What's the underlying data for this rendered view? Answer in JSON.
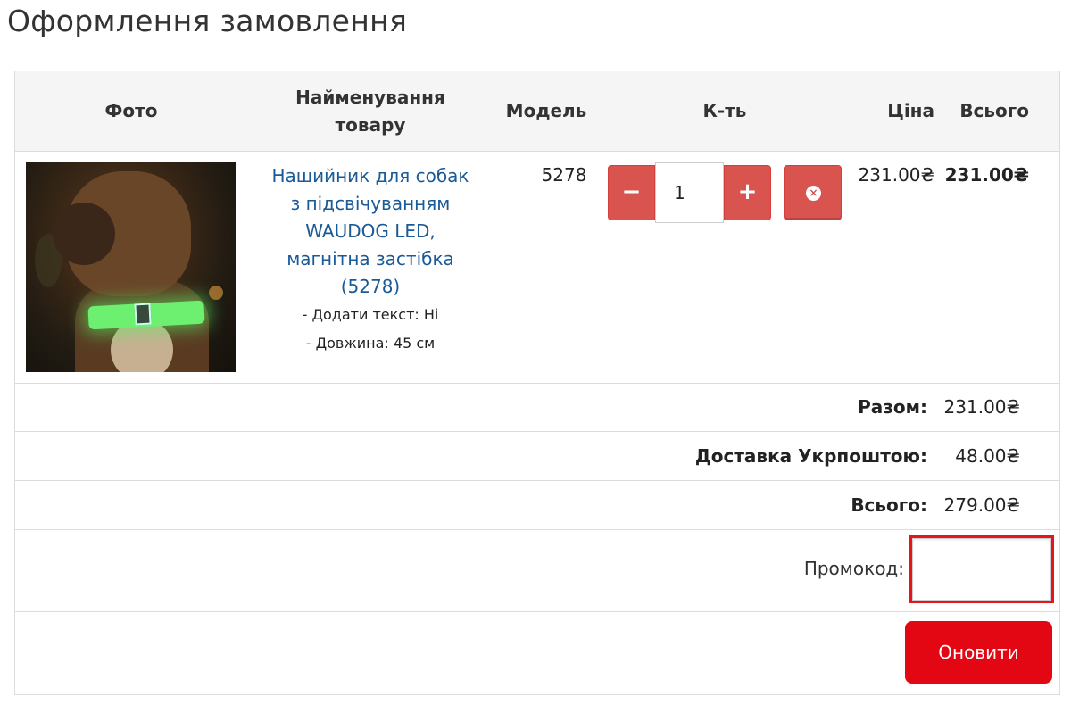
{
  "page": {
    "title": "Оформлення замовлення"
  },
  "cart": {
    "headers": {
      "photo": "Фото",
      "name": "Найменування товару",
      "model": "Модель",
      "qty": "К-ть",
      "price": "Ціна",
      "total": "Всього"
    },
    "items": [
      {
        "name_lines": [
          "Нашийник для собак",
          "з підсвічуванням",
          "WAUDOG LED,",
          "магнітна застібка",
          "(5278)"
        ],
        "options": [
          "- Додати текст: Ні",
          "- Довжина: 45 см"
        ],
        "model": "5278",
        "qty": "1",
        "price": "231.00₴",
        "total": "231.00₴",
        "photo_alt": "dog with glowing green LED collar"
      }
    ],
    "minus_icon": "−",
    "plus_icon": "+",
    "remove_icon": "×"
  },
  "totals": [
    {
      "label": "Разом:",
      "value": "231.00₴"
    },
    {
      "label": "Доставка Укрпоштою:",
      "value": "48.00₴"
    },
    {
      "label": "Всього:",
      "value": "279.00₴"
    }
  ],
  "promo": {
    "label": "Промокод:",
    "value": ""
  },
  "actions": {
    "update_label": "Оновити"
  },
  "colors": {
    "accent_red": "#e30613",
    "button_red": "#d9534f",
    "link_blue": "#1a5a96",
    "highlight": "#e8141b"
  }
}
